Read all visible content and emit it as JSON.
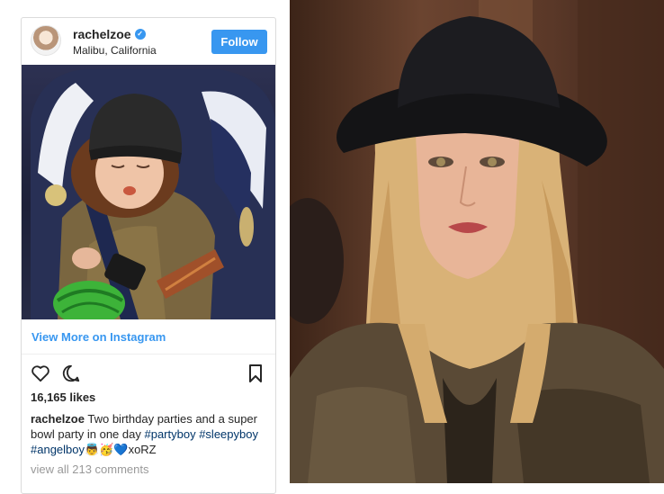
{
  "post": {
    "username": "rachelzoe",
    "location": "Malibu, California",
    "follow_label": "Follow",
    "view_more_label": "View More on Instagram",
    "likes": "16,165 likes",
    "caption_user": "rachelzoe",
    "caption_text": "Two birthday parties and a super bowl party in one day",
    "tags": [
      "#partyboy",
      "#sleepyboy",
      "#angelboy"
    ],
    "caption_end": "xoRZ",
    "emojis": "👼🥳💙",
    "comments_label": "view all 213 comments"
  },
  "icons": {
    "like": "heart-icon",
    "comment": "comment-icon",
    "save": "bookmark-icon",
    "verified": "verified-badge-icon"
  },
  "colors": {
    "follow_button": "#3897f0",
    "link": "#3897f0",
    "hashtag": "#003569",
    "muted_text": "#999999"
  }
}
